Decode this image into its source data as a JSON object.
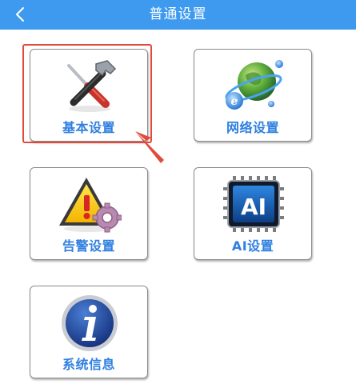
{
  "header": {
    "title": "普通设置",
    "back_icon": "chevron-left-icon",
    "bg_color": "#3d9aee"
  },
  "tiles": [
    {
      "label": "基本设置",
      "icon": "tools-icon"
    },
    {
      "label": "网络设置",
      "icon": "globe-network-icon"
    },
    {
      "label": "告警设置",
      "icon": "alarm-warning-icon"
    },
    {
      "label": "AI设置",
      "icon": "ai-chip-icon"
    },
    {
      "label": "系统信息",
      "icon": "info-icon"
    }
  ],
  "annotation": {
    "highlight_color": "#e24b3b",
    "highlighted_tile": "基本设置"
  },
  "colors": {
    "label": "#2f7fe0",
    "tile_border": "#8a8a8a"
  }
}
